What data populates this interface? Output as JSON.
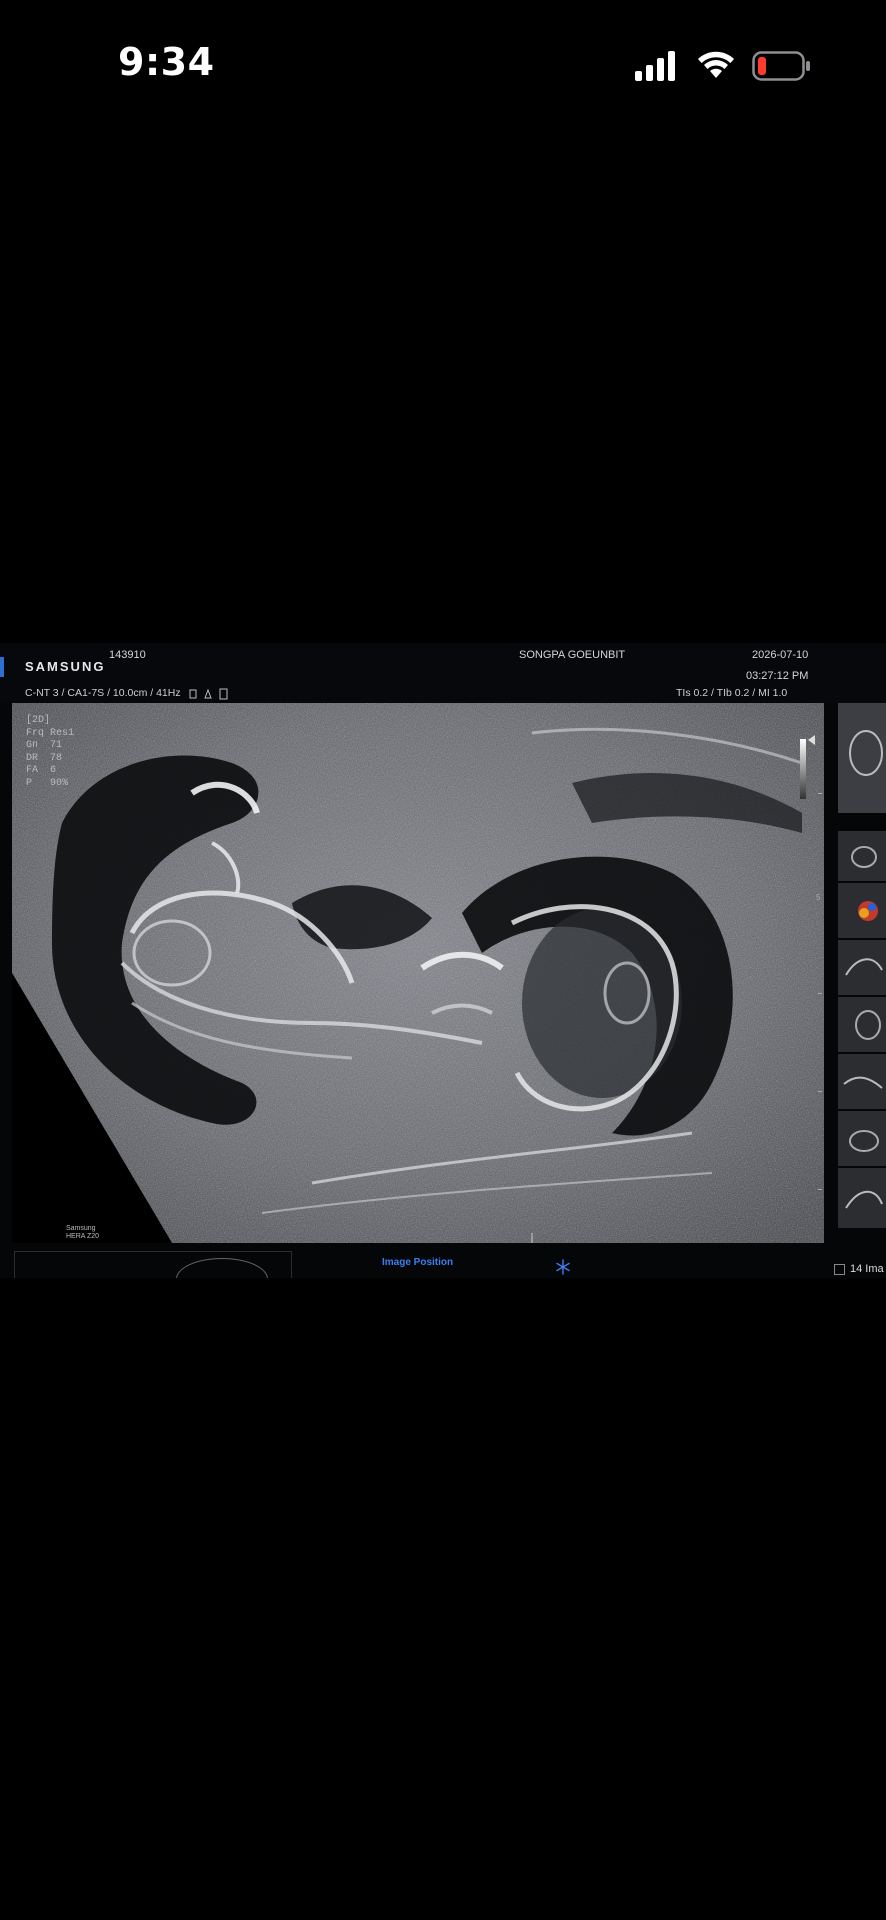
{
  "status_bar": {
    "time": "9:34",
    "icons": [
      "cellular-signal-icon",
      "wifi-icon",
      "battery-low-icon"
    ],
    "battery_color": "#ff3b30"
  },
  "ultrasound": {
    "brand": "SAMSUNG",
    "patient_id": "143910",
    "institution": "SONGPA GOEUNBIT",
    "date": "2026-07-10",
    "time": "03:27:12 PM",
    "probe_info": "C-NT 3 / CA1-7S / 10.0cm / 41Hz",
    "power_info": "TIs  0.2 / TIb  0.2 / MI    1.0",
    "params": [
      {
        "label": "[2D]",
        "value": ""
      },
      {
        "label": "Frq",
        "value": "Res1"
      },
      {
        "label": "Gn",
        "value": "71"
      },
      {
        "label": "DR",
        "value": "78"
      },
      {
        "label": "FA",
        "value": "6"
      },
      {
        "label": "P",
        "value": "90%"
      }
    ],
    "depth_label": "5",
    "watermark": [
      "Samsung",
      "HERA Z20"
    ],
    "image_position_label": "Image Position",
    "image_count": "14 Ima",
    "accent": "#3d7ef0"
  }
}
